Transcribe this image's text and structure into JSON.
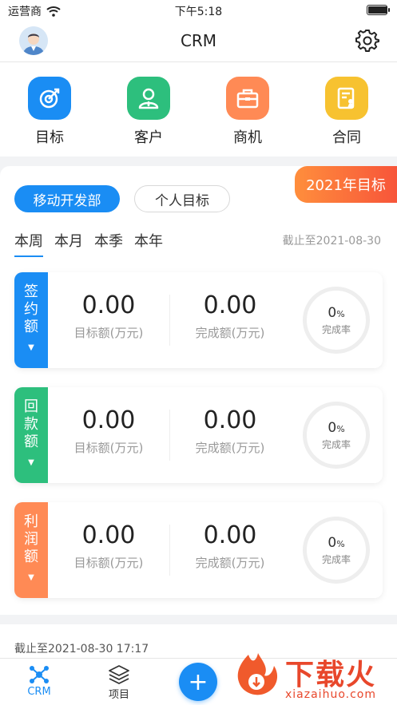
{
  "status_bar": {
    "carrier": "运营商",
    "time": "下午5:18"
  },
  "nav": {
    "title": "CRM"
  },
  "quick_actions": [
    {
      "label": "目标",
      "icon": "target-icon",
      "color": "#1a8df4"
    },
    {
      "label": "客户",
      "icon": "person-icon",
      "color": "#2dbf7d"
    },
    {
      "label": "商机",
      "icon": "briefcase-icon",
      "color": "#ff8a55"
    },
    {
      "label": "合同",
      "icon": "contract-icon",
      "color": "#f7c230"
    }
  ],
  "goals": {
    "year_badge": "2021年目标",
    "scope_tabs": [
      "移动开发部",
      "个人目标"
    ],
    "periods": [
      "本周",
      "本月",
      "本季",
      "本年"
    ],
    "deadline": "截止至2021-08-30",
    "metrics": [
      {
        "side_chars": [
          "签",
          "约",
          "额"
        ],
        "color": "#1a8df4",
        "target": "0.00",
        "target_label": "目标额(万元)",
        "done": "0.00",
        "done_label": "完成额(万元)",
        "rate": "0",
        "rate_unit": "%",
        "rate_label": "完成率"
      },
      {
        "side_chars": [
          "回",
          "款",
          "额"
        ],
        "color": "#2dbf7d",
        "target": "0.00",
        "target_label": "目标额(万元)",
        "done": "0.00",
        "done_label": "完成额(万元)",
        "rate": "0",
        "rate_unit": "%",
        "rate_label": "完成率"
      },
      {
        "side_chars": [
          "利",
          "润",
          "额"
        ],
        "color": "#ff8a55",
        "target": "0.00",
        "target_label": "目标额(万元)",
        "done": "0.00",
        "done_label": "完成额(万元)",
        "rate": "0",
        "rate_unit": "%",
        "rate_label": "完成率"
      }
    ]
  },
  "footer": {
    "deadline": "截止至2021-08-30 17:17"
  },
  "tabbar": {
    "items": [
      "CRM",
      "项目"
    ]
  },
  "watermark": {
    "main": "下载火",
    "sub": "xiazaihuo.com"
  }
}
